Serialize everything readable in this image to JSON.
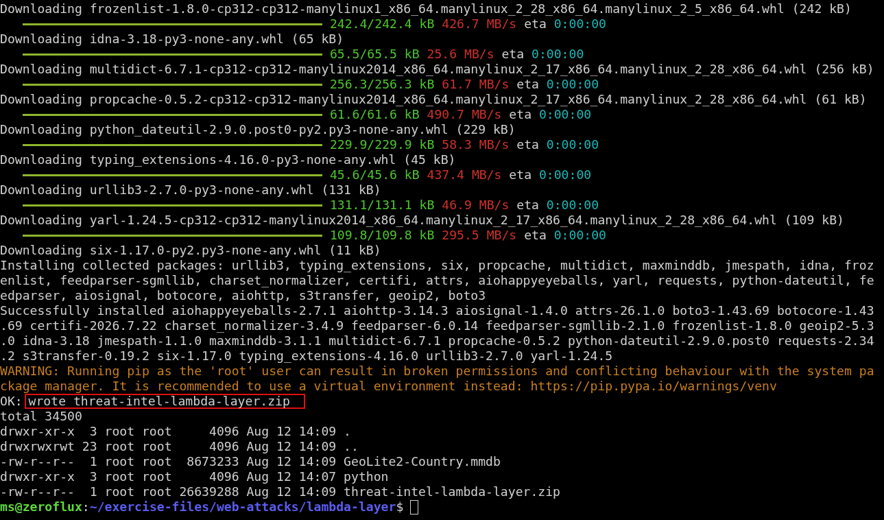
{
  "terminal": {
    "lines": [
      {
        "kind": "plain",
        "text": "Downloading frozenlist-1.8.0-cp312-cp312-manylinux1_x86_64.manylinux_2_28_x86_64.manylinux_2_5_x86_64.whl (242 kB)"
      },
      {
        "kind": "progress",
        "level": 1,
        "amount": "242.4/242.4 kB",
        "rate": "426.7 MB/s",
        "eta_label": "eta",
        "eta": "0:00:00"
      },
      {
        "kind": "plain",
        "text": "Downloading idna-3.18-py3-none-any.whl (65 kB)"
      },
      {
        "kind": "progress",
        "level": 1,
        "amount": "65.5/65.5 kB",
        "rate": "25.6 MB/s",
        "eta_label": "eta",
        "eta": "0:00:00"
      },
      {
        "kind": "plain",
        "text": "Downloading multidict-6.7.1-cp312-cp312-manylinux2014_x86_64.manylinux_2_17_x86_64.manylinux_2_28_x86_64.whl (256 kB)"
      },
      {
        "kind": "progress",
        "level": 1,
        "amount": "256.3/256.3 kB",
        "rate": "61.7 MB/s",
        "eta_label": "eta",
        "eta": "0:00:00"
      },
      {
        "kind": "plain",
        "text": "Downloading propcache-0.5.2-cp312-cp312-manylinux2014_x86_64.manylinux_2_17_x86_64.manylinux_2_28_x86_64.whl (61 kB)"
      },
      {
        "kind": "progress",
        "level": 1,
        "amount": "61.6/61.6 kB",
        "rate": "490.7 MB/s",
        "eta_label": "eta",
        "eta": "0:00:00"
      },
      {
        "kind": "plain",
        "text": "Downloading python_dateutil-2.9.0.post0-py2.py3-none-any.whl (229 kB)"
      },
      {
        "kind": "progress",
        "level": 1,
        "amount": "229.9/229.9 kB",
        "rate": "58.3 MB/s",
        "eta_label": "eta",
        "eta": "0:00:00"
      },
      {
        "kind": "plain",
        "text": "Downloading typing_extensions-4.16.0-py3-none-any.whl (45 kB)"
      },
      {
        "kind": "progress",
        "level": 1,
        "amount": "45.6/45.6 kB",
        "rate": "437.4 MB/s",
        "eta_label": "eta",
        "eta": "0:00:00"
      },
      {
        "kind": "plain",
        "text": "Downloading urllib3-2.7.0-py3-none-any.whl (131 kB)"
      },
      {
        "kind": "progress",
        "level": 1,
        "amount": "131.1/131.1 kB",
        "rate": "46.9 MB/s",
        "eta_label": "eta",
        "eta": "0:00:00"
      },
      {
        "kind": "plain",
        "text": "Downloading yarl-1.24.5-cp312-cp312-manylinux2014_x86_64.manylinux_2_17_x86_64.manylinux_2_28_x86_64.whl (109 kB)"
      },
      {
        "kind": "progress",
        "level": 1,
        "amount": "109.8/109.8 kB",
        "rate": "295.5 MB/s",
        "eta_label": "eta",
        "eta": "0:00:00"
      },
      {
        "kind": "plain",
        "text": "Downloading six-1.17.0-py2.py3-none-any.whl (11 kB)"
      },
      {
        "kind": "plain",
        "text": "Installing collected packages: urllib3, typing_extensions, six, propcache, multidict, maxminddb, jmespath, idna, froz"
      },
      {
        "kind": "plain",
        "text": "enlist, feedparser-sgmllib, charset_normalizer, certifi, attrs, aiohappyeyeballs, yarl, requests, python-dateutil, fe"
      },
      {
        "kind": "plain",
        "text": "edparser, aiosignal, botocore, aiohttp, s3transfer, geoip2, boto3"
      },
      {
        "kind": "plain",
        "text": "Successfully installed aiohappyeyeballs-2.7.1 aiohttp-3.14.3 aiosignal-1.4.0 attrs-26.1.0 boto3-1.43.69 botocore-1.43"
      },
      {
        "kind": "plain",
        "text": ".69 certifi-2026.7.22 charset_normalizer-3.4.9 feedparser-6.0.14 feedparser-sgmllib-2.1.0 frozenlist-1.8.0 geoip2-5.3"
      },
      {
        "kind": "plain",
        "text": ".0 idna-3.18 jmespath-1.1.0 maxminddb-3.1.1 multidict-6.7.1 propcache-0.5.2 python-dateutil-2.9.0.post0 requests-2.34"
      },
      {
        "kind": "plain",
        "text": ".2 s3transfer-0.19.2 six-1.17.0 typing_extensions-4.16.0 urllib3-2.7.0 yarl-1.24.5"
      },
      {
        "kind": "warning",
        "text": "WARNING: Running pip as the 'root' user can result in broken permissions and conflicting behaviour with the system pa"
      },
      {
        "kind": "warning",
        "text": "ckage manager. It is recommended to use a virtual environment instead: https://pip.pypa.io/warnings/venv"
      },
      {
        "kind": "result",
        "status": "OK:",
        "message": "wrote threat-intel-lambda-layer.zip",
        "boxed": true
      },
      {
        "kind": "plain",
        "text": "total 34500"
      },
      {
        "kind": "plain",
        "text": "drwxr-xr-x  3 root root     4096 Aug 12 14:09 ."
      },
      {
        "kind": "plain",
        "text": "drwxrwxrwt 23 root root     4096 Aug 12 14:09 .."
      },
      {
        "kind": "plain",
        "text": "-rw-r--r--  1 root root  8673233 Aug 12 14:09 GeoLite2-Country.mmdb"
      },
      {
        "kind": "plain",
        "text": "drwxr-xr-x  3 root root     4096 Aug 12 14:07 python"
      },
      {
        "kind": "plain",
        "text": "-rw-r--r--  1 root root 26639288 Aug 12 14:09 threat-intel-lambda-layer.zip"
      },
      {
        "kind": "prompt",
        "user_host": "ms@zeroflux",
        "separator": ":",
        "path": "~/exercise-files/web-attacks/lambda-layer",
        "symbol": "$"
      }
    ]
  }
}
